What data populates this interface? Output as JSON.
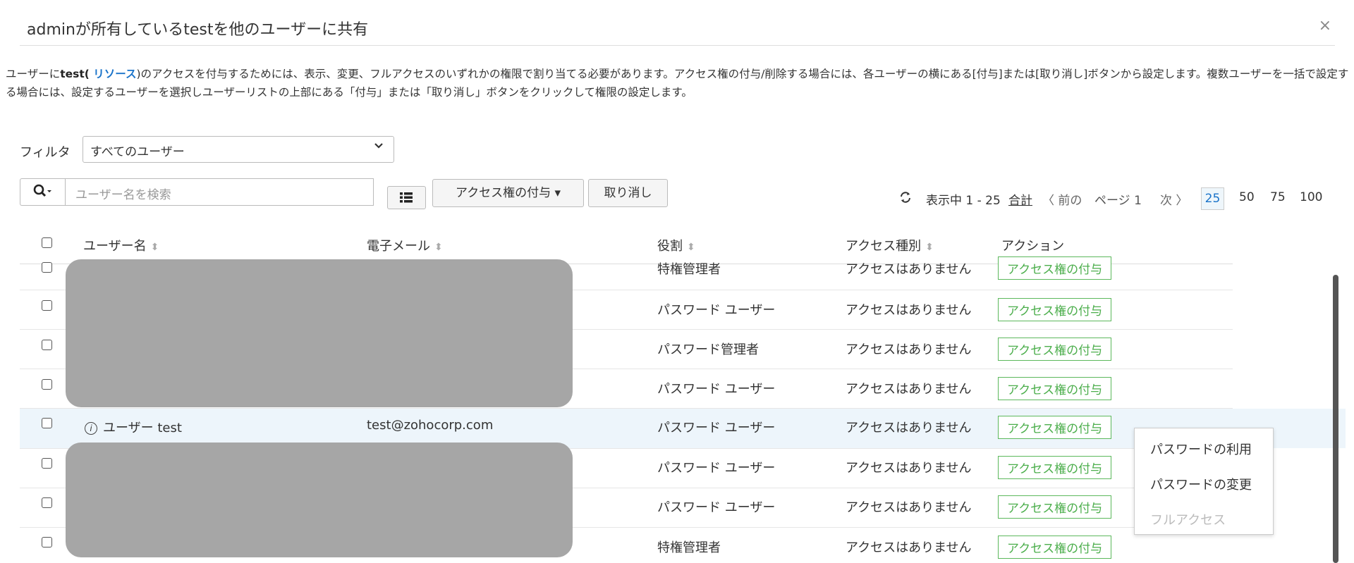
{
  "dialog": {
    "title": "adminが所有しているtestを他のユーザーに共有",
    "close": "×"
  },
  "description": {
    "pre": "ユーザーに",
    "resource_name": "test(",
    "resource_link": " リソース",
    "post": ")のアクセスを付与するためには、表示、変更、フルアクセスのいずれかの権限で割り当てる必要があります。アクセス権の付与/削除する場合には、各ユーザーの横にある[付与]または[取り消し]ボタンから設定します。複数ユーザーを一括で設定する場合には、設定するユーザーを選択しユーザーリストの上部にある「付与」または「取り消し」ボタンをクリックして権限の設定します。"
  },
  "filter": {
    "label": "フィルタ",
    "selected": "すべてのユーザー"
  },
  "toolbar": {
    "search_placeholder": "ユーザー名を検索",
    "grant_label": "アクセス権の付与 ▾",
    "revoke_label": "取り消し"
  },
  "pager": {
    "showing": "表示中 1 - 25",
    "total": "合計",
    "prev": "〈 前の",
    "page": "ページ 1",
    "next": "次 〉",
    "sizes": [
      "25",
      "50",
      "75",
      "100"
    ]
  },
  "table": {
    "headers": {
      "username": "ユーザー名",
      "email": "電子メール",
      "role": "役割",
      "access_type": "アクセス種別",
      "action": "アクション"
    },
    "rows": [
      {
        "user": "",
        "email": "",
        "role": "特権管理者",
        "access": "アクセスはありません",
        "action": "アクセス権の付与"
      },
      {
        "user": "",
        "email": "",
        "role": "パスワード ユーザー",
        "access": "アクセスはありません",
        "action": "アクセス権の付与"
      },
      {
        "user": "",
        "email": "",
        "role": "パスワード管理者",
        "access": "アクセスはありません",
        "action": "アクセス権の付与"
      },
      {
        "user": "",
        "email": "",
        "role": "パスワード ユーザー",
        "access": "アクセスはありません",
        "action": "アクセス権の付与"
      },
      {
        "user": "ユーザー test",
        "email": "test@zohocorp.com",
        "role": "パスワード ユーザー",
        "access": "アクセスはありません",
        "action": "アクセス権の付与"
      },
      {
        "user": "",
        "email": "",
        "role": "パスワード ユーザー",
        "access": "アクセスはありません",
        "action": "アクセス権の付与"
      },
      {
        "user": "",
        "email": "",
        "role": "パスワード ユーザー",
        "access": "アクセスはありません",
        "action": "アクセス権の付与"
      },
      {
        "user": "",
        "email": "",
        "role": "特権管理者",
        "access": "アクセスはありません",
        "action": "アクセス権の付与"
      }
    ]
  },
  "dropdown_menu": {
    "items": [
      "パスワードの利用",
      "パスワードの変更",
      "フルアクセス"
    ],
    "disabled": [
      false,
      false,
      true
    ]
  },
  "colors": {
    "grant_green": "#4cae4c",
    "link_blue": "#1a73c9",
    "redaction_gray": "#a6a6a6",
    "highlight_row": "#edf5fb"
  }
}
